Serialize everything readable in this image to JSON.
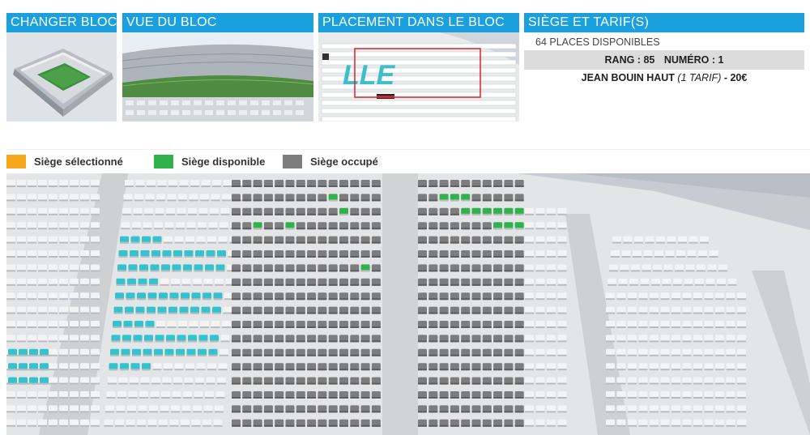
{
  "panels": {
    "change_block": "CHANGER BLOC",
    "block_view": "VUE DU BLOC",
    "placement": "PLACEMENT DANS LE BLOC",
    "seat_price": "SIÈGE ET TARIF(S)"
  },
  "placement_image_text": "LLE",
  "seat_info": {
    "places_available": "64 PLACES DISPONIBLES",
    "rang": "RANG : 85",
    "numero": "NUMÉRO : 1",
    "tribune": "JEAN BOUIN HAUT",
    "tarif_count": "(1 TARIF)",
    "price": "- 20€"
  },
  "legend": [
    {
      "label": "Siège sélectionné",
      "color": "#f5a81c"
    },
    {
      "label": "Siège disponible",
      "color": "#2fb24c"
    },
    {
      "label": "Siège occupé",
      "color": "#7d7d7d"
    }
  ],
  "colors": {
    "accent": "#1ba0de",
    "selected": "#f5a81c",
    "available": "#2fb24c",
    "occupied": "#7d7d7d",
    "other_block": "#34c2cf"
  }
}
